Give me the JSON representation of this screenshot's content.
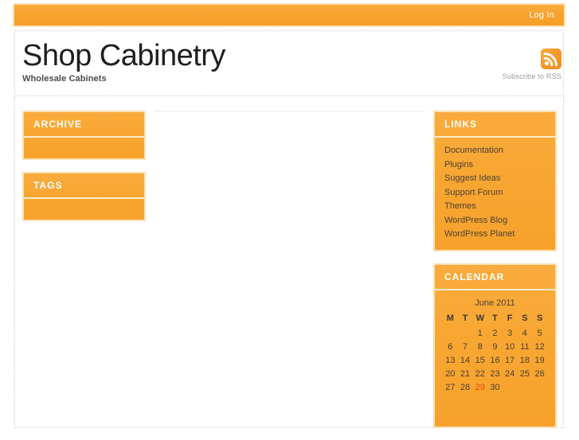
{
  "topbar": {
    "login_label": "Log In"
  },
  "header": {
    "site_title": "Shop Cabinetry",
    "site_description": "Wholesale Cabinets",
    "rss": {
      "icon": "rss-icon",
      "label": "Subscribe to RSS"
    }
  },
  "colors": {
    "accent_orange": "#F6A22C",
    "accent_orange_light": "#F9AB3C",
    "widget_border": "#FBE0B4",
    "today_highlight": "#E24A0E",
    "link_text": "#4D4134",
    "muted_text": "#9B9B9B"
  },
  "sidebar_left": {
    "widgets": [
      {
        "title": "ARCHIVE",
        "items": []
      },
      {
        "title": "TAGS",
        "items": []
      }
    ]
  },
  "sidebar_right": {
    "links_widget": {
      "title": "LINKS",
      "items": [
        "Documentation",
        "Plugins",
        "Suggest Ideas",
        "Support Forum",
        "Themes",
        "WordPress Blog",
        "WordPress Planet"
      ]
    },
    "calendar_widget": {
      "title": "CALENDAR",
      "caption": "June 2011",
      "weekdays": [
        "M",
        "T",
        "W",
        "T",
        "F",
        "S",
        "S"
      ],
      "weeks": [
        [
          "",
          "",
          "1",
          "2",
          "3",
          "4",
          "5"
        ],
        [
          "6",
          "7",
          "8",
          "9",
          "10",
          "11",
          "12"
        ],
        [
          "13",
          "14",
          "15",
          "16",
          "17",
          "18",
          "19"
        ],
        [
          "20",
          "21",
          "22",
          "23",
          "24",
          "25",
          "26"
        ],
        [
          "27",
          "28",
          "29",
          "30",
          "",
          "",
          ""
        ]
      ],
      "today": "29"
    }
  },
  "main": {
    "content": ""
  }
}
